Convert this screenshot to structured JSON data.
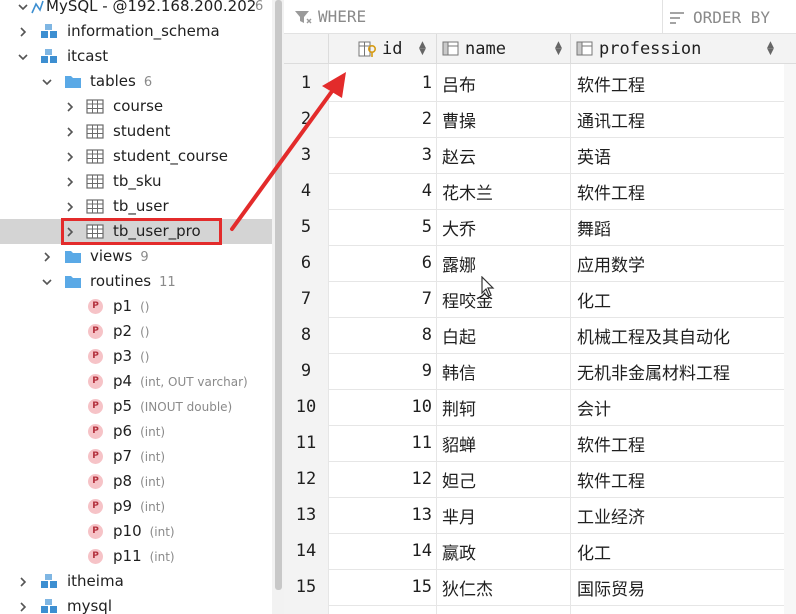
{
  "tree": {
    "header": {
      "label": "MySQL - @192.168.200.202",
      "badge": "6"
    },
    "items": [
      {
        "label": "information_schema"
      },
      {
        "label": "itcast"
      },
      {
        "label": "tables",
        "count": "6"
      },
      {
        "label": "course"
      },
      {
        "label": "student"
      },
      {
        "label": "student_course"
      },
      {
        "label": "tb_sku"
      },
      {
        "label": "tb_user"
      },
      {
        "label": "tb_user_pro"
      },
      {
        "label": "views",
        "count": "9"
      },
      {
        "label": "routines",
        "count": "11"
      },
      {
        "label": "itheima"
      },
      {
        "label": "mysql"
      }
    ],
    "routines": [
      {
        "name": "p1",
        "params": "()"
      },
      {
        "name": "p2",
        "params": "()"
      },
      {
        "name": "p3",
        "params": "()"
      },
      {
        "name": "p4",
        "params": "(int, OUT varchar)"
      },
      {
        "name": "p5",
        "params": "(INOUT double)"
      },
      {
        "name": "p6",
        "params": "(int)"
      },
      {
        "name": "p7",
        "params": "(int)"
      },
      {
        "name": "p8",
        "params": "(int)"
      },
      {
        "name": "p9",
        "params": "(int)"
      },
      {
        "name": "p10",
        "params": "(int)"
      },
      {
        "name": "p11",
        "params": "(int)"
      }
    ],
    "routine_badge": "P"
  },
  "filter": {
    "where": "WHERE",
    "order_by": "ORDER BY"
  },
  "columns": [
    {
      "label": "id"
    },
    {
      "label": "name"
    },
    {
      "label": "profession"
    }
  ],
  "rows": [
    {
      "num": "1",
      "id": "1",
      "name": "吕布",
      "profession": "软件工程"
    },
    {
      "num": "2",
      "id": "2",
      "name": "曹操",
      "profession": "通讯工程"
    },
    {
      "num": "3",
      "id": "3",
      "name": "赵云",
      "profession": "英语"
    },
    {
      "num": "4",
      "id": "4",
      "name": "花木兰",
      "profession": "软件工程"
    },
    {
      "num": "5",
      "id": "5",
      "name": "大乔",
      "profession": "舞蹈"
    },
    {
      "num": "6",
      "id": "6",
      "name": "露娜",
      "profession": "应用数学"
    },
    {
      "num": "7",
      "id": "7",
      "name": "程咬金",
      "profession": "化工"
    },
    {
      "num": "8",
      "id": "8",
      "name": "白起",
      "profession": "机械工程及其自动化"
    },
    {
      "num": "9",
      "id": "9",
      "name": "韩信",
      "profession": "无机非金属材料工程"
    },
    {
      "num": "10",
      "id": "10",
      "name": "荆轲",
      "profession": "会计"
    },
    {
      "num": "11",
      "id": "11",
      "name": "貂蝉",
      "profession": "软件工程"
    },
    {
      "num": "12",
      "id": "12",
      "name": "妲己",
      "profession": "软件工程"
    },
    {
      "num": "13",
      "id": "13",
      "name": "芈月",
      "profession": "工业经济"
    },
    {
      "num": "14",
      "id": "14",
      "name": "嬴政",
      "profession": "化工"
    },
    {
      "num": "15",
      "id": "15",
      "name": "狄仁杰",
      "profession": "国际贸易"
    }
  ],
  "colors": {
    "highlight": "#e32b2b",
    "selected_row": "#d4d4d4",
    "db_icon": "#3d8fd1",
    "folder_icon": "#5aa9e6",
    "routine_badge_bg": "#f6c3c7"
  }
}
